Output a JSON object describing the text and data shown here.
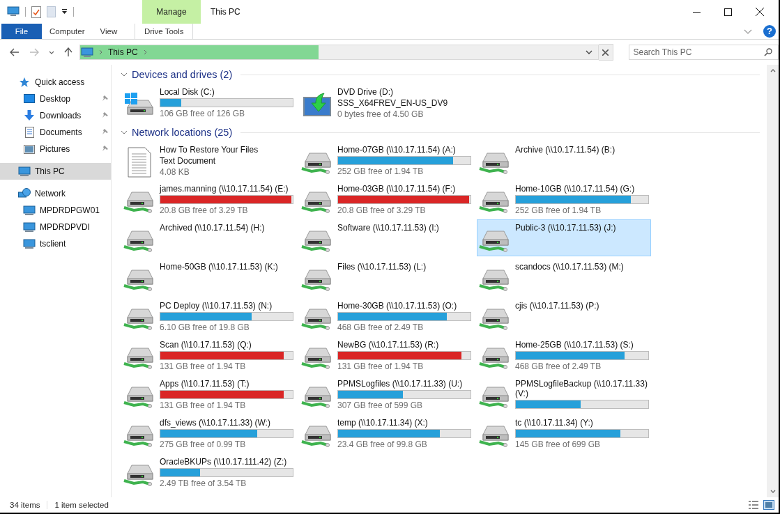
{
  "window": {
    "title": "This PC"
  },
  "ribbon": {
    "context_header": "Manage",
    "tabs": [
      {
        "label": "File",
        "kind": "file",
        "selected": false
      },
      {
        "label": "Computer",
        "kind": "tab",
        "selected": false
      },
      {
        "label": "View",
        "kind": "tab",
        "selected": false
      },
      {
        "label": "Drive Tools",
        "kind": "context",
        "selected": false
      }
    ]
  },
  "help": {
    "label": "?"
  },
  "address_bar": {
    "crumbs": [
      "This PC"
    ],
    "level": 0.46
  },
  "search": {
    "placeholder": "Search This PC"
  },
  "sidebar": {
    "items": [
      {
        "label": "Quick access",
        "kind": "star",
        "selected": false,
        "children": [
          {
            "label": "Desktop",
            "kind": "desktop",
            "pinned": true,
            "selected": false
          },
          {
            "label": "Downloads",
            "kind": "download",
            "pinned": true,
            "selected": false
          },
          {
            "label": "Documents",
            "kind": "document",
            "pinned": true,
            "selected": false
          },
          {
            "label": "Pictures",
            "kind": "picture",
            "pinned": true,
            "selected": false
          }
        ]
      },
      {
        "label": "This PC",
        "kind": "pc",
        "selected": true
      },
      {
        "label": "Network",
        "kind": "network",
        "selected": false,
        "children": [
          {
            "label": "MPDRDPGW01",
            "kind": "pc",
            "selected": false
          },
          {
            "label": "MPDRDPVDI",
            "kind": "pc",
            "selected": false
          },
          {
            "label": "tsclient",
            "kind": "pc",
            "selected": false
          }
        ]
      }
    ]
  },
  "groups": [
    {
      "title": "Devices and drives (2)",
      "items": [
        {
          "kind": "local-disk",
          "name": "Local Disk (C:)",
          "level": 0.16,
          "critical": false,
          "free": "106 GB free of 126 GB",
          "selected": false
        },
        {
          "kind": "dvd",
          "name": "DVD Drive (D:)",
          "label": "SSS_X64FREV_EN-US_DV9",
          "free": "0 bytes free of 4.50 GB",
          "selected": false
        }
      ]
    },
    {
      "title": "Network locations (25)",
      "items": [
        {
          "kind": "document",
          "name": "How To Restore Your Files",
          "label": "Text Document",
          "free": "4.08 KB",
          "selected": false
        },
        {
          "kind": "network-drive",
          "name": "Home-07GB (\\\\10.17.11.54) (A:)",
          "level": 0.87,
          "critical": false,
          "free": "252 GB free of 1.94 TB",
          "selected": false
        },
        {
          "kind": "network-drive",
          "name": "Archive (\\\\10.17.11.54) (B:)",
          "selected": false
        },
        {
          "kind": "network-drive",
          "name": "james.manning (\\\\10.17.11.54) (E:)",
          "level": 0.99,
          "critical": true,
          "free": "20.8 GB free of 3.29 TB",
          "selected": false
        },
        {
          "kind": "network-drive",
          "name": "Home-03GB (\\\\10.17.11.54) (F:)",
          "level": 0.99,
          "critical": true,
          "free": "20.8 GB free of 3.29 TB",
          "selected": false
        },
        {
          "kind": "network-drive",
          "name": "Home-10GB (\\\\10.17.11.54) (G:)",
          "level": 0.87,
          "critical": false,
          "free": "252 GB free of 1.94 TB",
          "selected": false
        },
        {
          "kind": "network-drive",
          "name": "Archived (\\\\10.17.11.54) (H:)",
          "selected": false
        },
        {
          "kind": "network-drive",
          "name": "Software (\\\\10.17.11.53) (I:)",
          "selected": false
        },
        {
          "kind": "network-drive",
          "name": "Public-3 (\\\\10.17.11.53) (J:)",
          "selected": true
        },
        {
          "kind": "network-drive",
          "name": "Home-50GB (\\\\10.17.11.53) (K:)",
          "selected": false
        },
        {
          "kind": "network-drive",
          "name": "Files (\\\\10.17.11.53) (L:)",
          "selected": false
        },
        {
          "kind": "network-drive",
          "name": "scandocs (\\\\10.17.11.53) (M:)",
          "selected": false
        },
        {
          "kind": "network-drive",
          "name": "PC Deploy (\\\\10.17.11.53) (N:)",
          "level": 0.69,
          "critical": false,
          "free": "6.10 GB free of 19.8 GB",
          "selected": false
        },
        {
          "kind": "network-drive",
          "name": "Home-30GB (\\\\10.17.11.53) (O:)",
          "level": 0.82,
          "critical": false,
          "free": "468 GB free of 2.49 TB",
          "selected": false
        },
        {
          "kind": "network-drive",
          "name": "cjis (\\\\10.17.11.53) (P:)",
          "selected": false
        },
        {
          "kind": "network-drive",
          "name": "Scan (\\\\10.17.11.53) (Q:)",
          "level": 0.93,
          "critical": true,
          "free": "131 GB free of 1.94 TB",
          "selected": false
        },
        {
          "kind": "network-drive",
          "name": "NewBG (\\\\10.17.11.53) (R:)",
          "level": 0.93,
          "critical": true,
          "free": "131 GB free of 1.94 TB",
          "selected": false
        },
        {
          "kind": "network-drive",
          "name": "Home-25GB (\\\\10.17.11.53) (S:)",
          "level": 0.82,
          "critical": false,
          "free": "468 GB free of 2.49 TB",
          "selected": false
        },
        {
          "kind": "network-drive",
          "name": "Apps (\\\\10.17.11.53) (T:)",
          "level": 0.93,
          "critical": true,
          "free": "131 GB free of 1.94 TB",
          "selected": false
        },
        {
          "kind": "network-drive",
          "name": "PPMSLogfiles (\\\\10.17.11.33) (U:)",
          "level": 0.49,
          "critical": false,
          "free": "307 GB free of 599 GB",
          "selected": false
        },
        {
          "kind": "network-drive",
          "name": "PPMSLogfileBackup (\\\\10.17.11.33) (V:)",
          "level": 0.49,
          "critical": false,
          "selected": false
        },
        {
          "kind": "network-drive",
          "name": "dfs_views (\\\\10.17.11.33) (W:)",
          "level": 0.73,
          "critical": false,
          "free": "275 GB free of 0.99 TB",
          "selected": false
        },
        {
          "kind": "network-drive",
          "name": "temp (\\\\10.17.11.34) (X:)",
          "level": 0.77,
          "critical": false,
          "free": "23.4 GB free of 99.8 GB",
          "selected": false
        },
        {
          "kind": "network-drive",
          "name": "tc (\\\\10.17.11.34) (Y:)",
          "level": 0.79,
          "critical": false,
          "free": "145 GB free of 699 GB",
          "selected": false
        },
        {
          "kind": "network-drive",
          "name": "OracleBKUPs (\\\\10.17.111.42) (Z:)",
          "level": 0.3,
          "critical": false,
          "free": "2.49 TB free of 3.54 TB",
          "selected": false
        }
      ]
    }
  ],
  "status_bar": {
    "item_count": "34 items",
    "selection": "1 item selected"
  }
}
